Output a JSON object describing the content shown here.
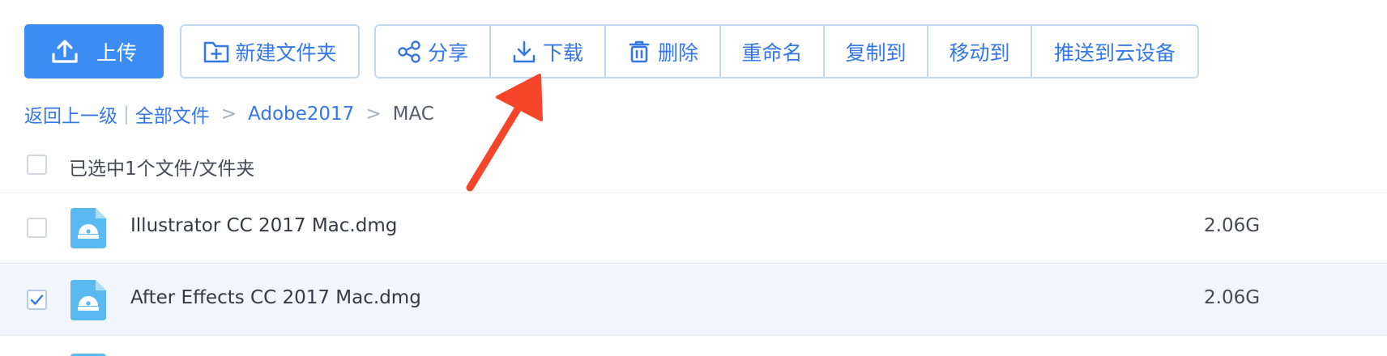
{
  "toolbar": {
    "upload_label": "上传",
    "new_folder_label": "新建文件夹",
    "actions": [
      {
        "label": "分享",
        "icon": "share-icon"
      },
      {
        "label": "下载",
        "icon": "download-icon"
      },
      {
        "label": "删除",
        "icon": "trash-icon"
      },
      {
        "label": "重命名"
      },
      {
        "label": "复制到"
      },
      {
        "label": "移动到"
      },
      {
        "label": "推送到云设备"
      }
    ]
  },
  "breadcrumb": {
    "back": "返回上一级",
    "separator": "|",
    "path": [
      "全部文件",
      "Adobe2017"
    ],
    "arrow": ">",
    "current": "MAC"
  },
  "selection": {
    "label": "已选中1个文件/文件夹"
  },
  "files": [
    {
      "name": "Illustrator CC 2017 Mac.dmg",
      "size": "2.06G",
      "checked": false
    },
    {
      "name": "After Effects CC 2017 Mac.dmg",
      "size": "2.06G",
      "checked": true
    }
  ],
  "colors": {
    "primary": "#3b8cf3",
    "link": "#3578e5",
    "border": "#c4d8f2",
    "selected_row": "#f1f6fd",
    "annotation": "#f5452a",
    "file_icon": "#5ab9f0"
  }
}
